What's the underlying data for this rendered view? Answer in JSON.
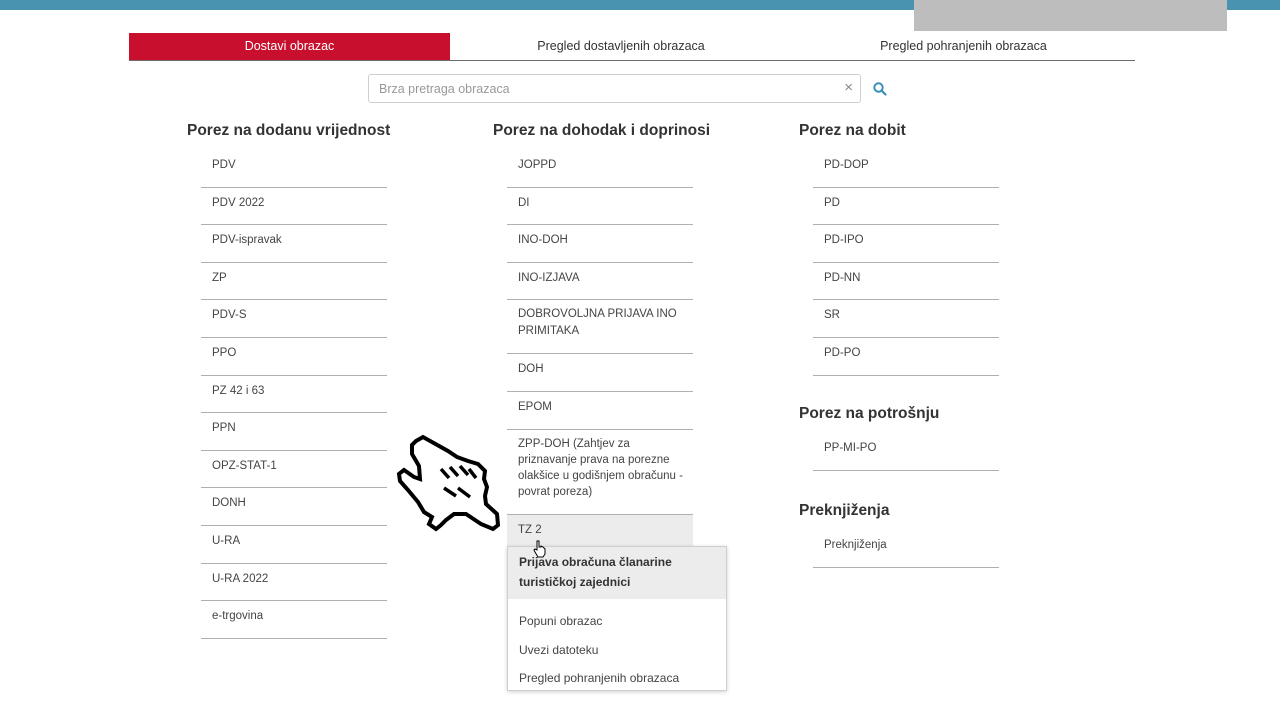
{
  "tabs": [
    {
      "label": "Dostavi obrazac",
      "active": true
    },
    {
      "label": "Pregled dostavljenih obrazaca",
      "active": false
    },
    {
      "label": "Pregled pohranjenih obrazaca",
      "active": false
    }
  ],
  "search": {
    "placeholder": "Brza pretraga obrazaca",
    "value": "",
    "clear_glyph": "×"
  },
  "columns": {
    "pdv": {
      "title": "Porez na dodanu vrijednost",
      "items": [
        "PDV",
        "PDV 2022",
        "PDV-ispravak",
        "ZP",
        "PDV-S",
        "PPO",
        "PZ 42 i 63",
        "PPN",
        "OPZ-STAT-1",
        "DONH",
        "U-RA",
        "U-RA 2022",
        "e-trgovina"
      ]
    },
    "dohodak": {
      "title": "Porez na dohodak i doprinosi",
      "items": [
        "JOPPD",
        "DI",
        "INO-DOH",
        "INO-IZJAVA",
        "DOBROVOLJNA PRIJAVA INO PRIMITAKA",
        "DOH",
        "EPOM",
        "ZPP-DOH (Zahtjev za priznavanje prava na porezne olakšice u godišnjem obračunu - povrat poreza)",
        "TZ 2"
      ]
    },
    "dobit": {
      "title": "Porez na dobit",
      "items": [
        "PD-DOP",
        "PD",
        "PD-IPO",
        "PD-NN",
        "SR",
        "PD-PO"
      ]
    },
    "potrosnja": {
      "title": "Porez na potrošnju",
      "items": [
        "PP-MI-PO"
      ]
    },
    "preknjizenja": {
      "title": "Preknjiženja",
      "items": [
        "Preknjiženja"
      ]
    }
  },
  "dropdown": {
    "description": "Prijava obračuna članarine turističkoj zajednici",
    "actions": [
      "Popuni obrazac",
      "Uvezi datoteku",
      "Pregled pohranjenih obrazaca"
    ]
  },
  "colors": {
    "accent": "#c8102e",
    "topbar": "#4a93b0",
    "search_icon": "#3a8fb7"
  },
  "icons": {
    "search": "search-icon",
    "clear": "clear-icon",
    "hand": "hand-pointer-icon",
    "cursor": "mouse-pointer-icon"
  }
}
